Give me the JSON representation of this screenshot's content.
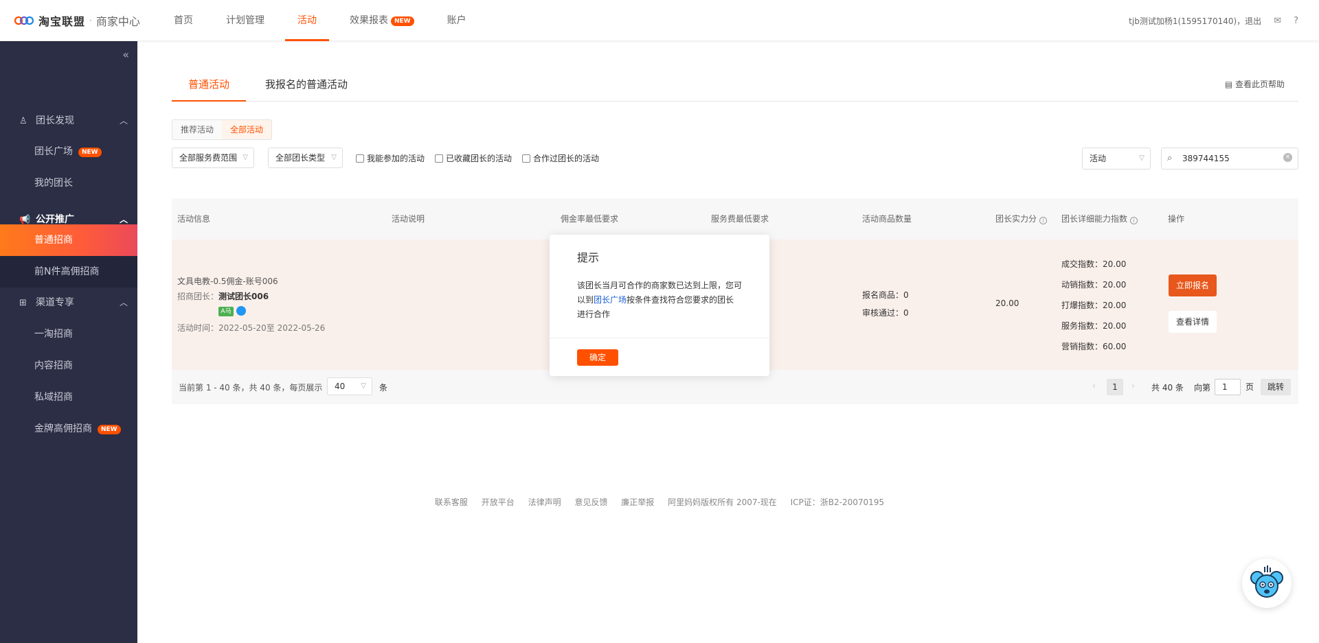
{
  "header": {
    "brand": "淘宝联盟",
    "brand_sub": "商家中心",
    "nav": [
      {
        "label": "首页"
      },
      {
        "label": "计划管理"
      },
      {
        "label": "活动"
      },
      {
        "label": "效果报表",
        "badge": "NEW"
      },
      {
        "label": "账户"
      }
    ],
    "user_text": "tjb测试加杨1(1595170140)",
    "logout": "，退出",
    "mail_icon": "mail-icon",
    "help_icon": "question-icon"
  },
  "sidebar": {
    "collapse_icon": "double-chevron-left-icon",
    "groups": [
      {
        "label": "团长发现",
        "icon": "user-icon"
      },
      {
        "label": "公开推广",
        "icon": "megaphone-icon"
      },
      {
        "label": "渠道专享",
        "icon": "hierarchy-icon"
      }
    ],
    "items": [
      {
        "label": "团长广场",
        "badge": "NEW"
      },
      {
        "label": "我的团长"
      },
      {
        "label": "普通招商"
      },
      {
        "label": "前N件高佣招商"
      },
      {
        "label": "一淘招商"
      },
      {
        "label": "内容招商"
      },
      {
        "label": "私域招商"
      },
      {
        "label": "金牌高佣招商",
        "badge": "NEW"
      }
    ]
  },
  "tabs": [
    {
      "label": "普通活动"
    },
    {
      "label": "我报名的普通活动"
    }
  ],
  "help_link": "查看此页帮助",
  "segment": [
    {
      "label": "推荐活动"
    },
    {
      "label": "全部活动"
    }
  ],
  "filters": {
    "service_range": "全部服务费范围",
    "leader_type": "全部团长类型",
    "checkboxes": [
      "我能参加的活动",
      "已收藏团长的活动",
      "合作过团长的活动"
    ],
    "search_type": "活动",
    "search_value": "389744155"
  },
  "table": {
    "columns": [
      "活动信息",
      "活动说明",
      "佣金率最低要求",
      "服务费最低要求",
      "活动商品数量",
      "团长实力分",
      "团长详细能力指数",
      "操作"
    ],
    "row": {
      "title": "文具电教-0.5佣金-账号006",
      "leader_label": "招商团长：",
      "leader_name": "测试团长006",
      "tag_text": "A马",
      "time_label": "活动时间：",
      "time_value": "2022-05-20至 2022-05-26",
      "goods_signed": "报名商品：0",
      "goods_approved": "审核通过：0",
      "score": "20.00",
      "indices": [
        "成交指数：20.00",
        "动销指数：20.00",
        "打爆指数：20.00",
        "服务指数：20.00",
        "营销指数：60.00"
      ],
      "apply_btn": "立即报名",
      "detail_btn": "查看详情"
    },
    "footer": {
      "summary": "当前第 1 - 40 条，共 40 条，每页展示",
      "page_size": "40",
      "unit": "条",
      "current_page": "1",
      "total": "共 40 条",
      "goto_label": "向第",
      "goto_value": "1",
      "page_unit": "页",
      "jump": "跳转"
    }
  },
  "modal": {
    "title": "提示",
    "text_before": "该团长当月可合作的商家数已达到上限，您可以到",
    "link": "团长广场",
    "text_after": "按条件查找符合您要求的团长进行合作",
    "ok": "确定"
  },
  "footer_links": [
    "联系客服",
    "开放平台",
    "法律声明",
    "意见反馈",
    "廉正举报",
    "阿里妈妈版权所有 2007-现在",
    "ICP证：浙B2-20070195"
  ],
  "colors": {
    "accent": "#ff5000",
    "sidebar_bg": "#2b2e44",
    "row_bg": "#faf0eb"
  }
}
